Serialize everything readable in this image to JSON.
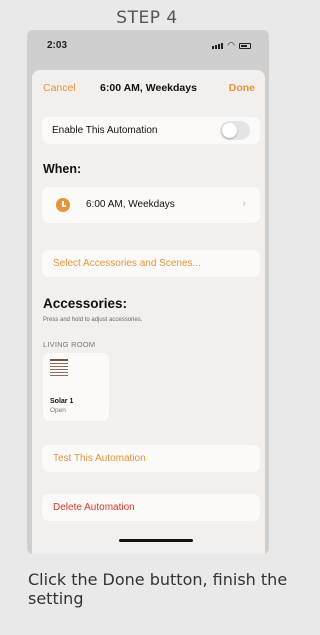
{
  "step_title": "STEP 4",
  "status": {
    "time": "2:03",
    "icons": [
      "signal-icon",
      "wifi-icon",
      "battery-icon"
    ]
  },
  "nav": {
    "cancel": "Cancel",
    "title": "6:00 AM, Weekdays",
    "done": "Done"
  },
  "enable": {
    "label": "Enable This Automation",
    "enabled": false
  },
  "when": {
    "heading": "When:",
    "value": "6:00 AM, Weekdays",
    "icon": "clock-icon",
    "chevron": "›"
  },
  "select_label": "Select Accessories and Scenes...",
  "accessories": {
    "heading": "Accessories:",
    "subtitle": "Press and hold to adjust accessories.",
    "room": "LIVING ROOM",
    "items": [
      {
        "name": "Solar 1",
        "state": "Open",
        "icon": "window-blind-icon"
      }
    ]
  },
  "test_label": "Test This Automation",
  "delete_label": "Delete Automation",
  "colors": {
    "accent": "#e3953a",
    "destructive": "#d23a2a",
    "sheet": "#f3efec",
    "card": "#fcfaf8"
  },
  "caption": "Click the Done button, finish the setting"
}
